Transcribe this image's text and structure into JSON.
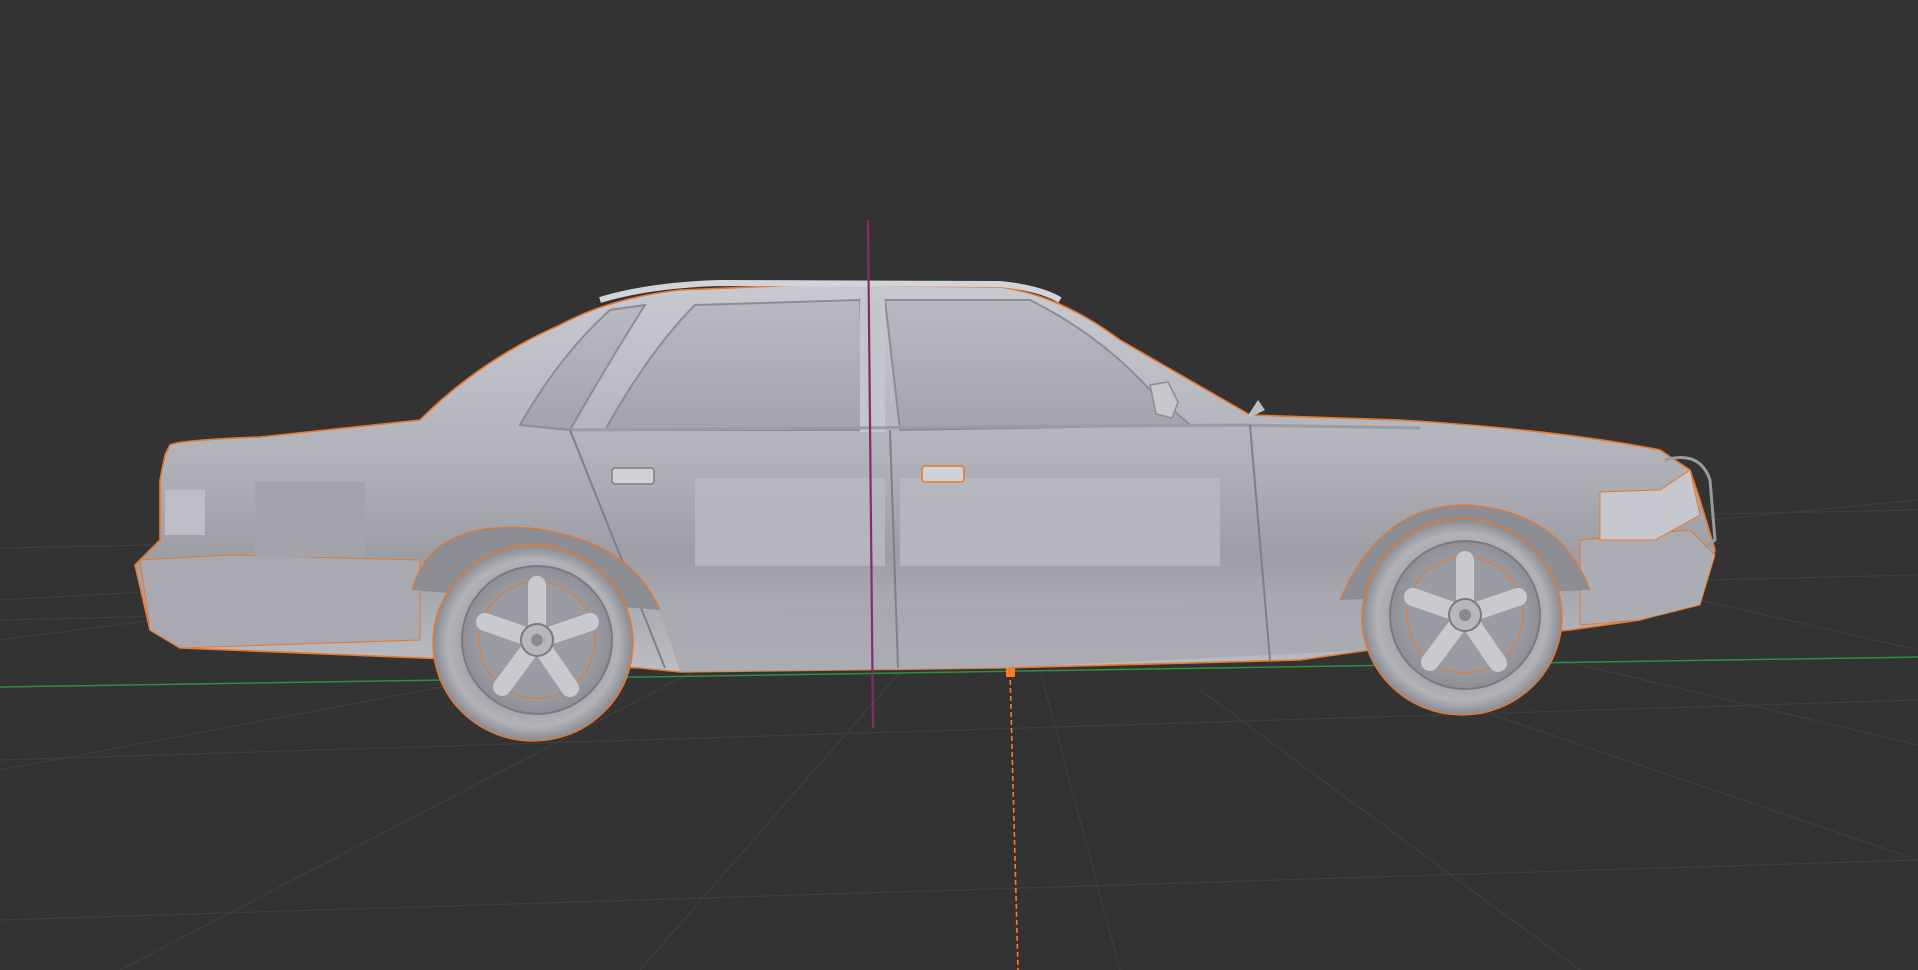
{
  "viewport": {
    "background_color": "#333333",
    "grid_color": "#3f3f3f",
    "x_axis_color": "#2f8f3f",
    "selection_outline_color": "#e8782a",
    "mesh_color": "#b4b4bc",
    "cursor_line_color": "#8a2a6a",
    "origin_color": "#ff7a20",
    "selected_object": "car-body-mesh"
  }
}
